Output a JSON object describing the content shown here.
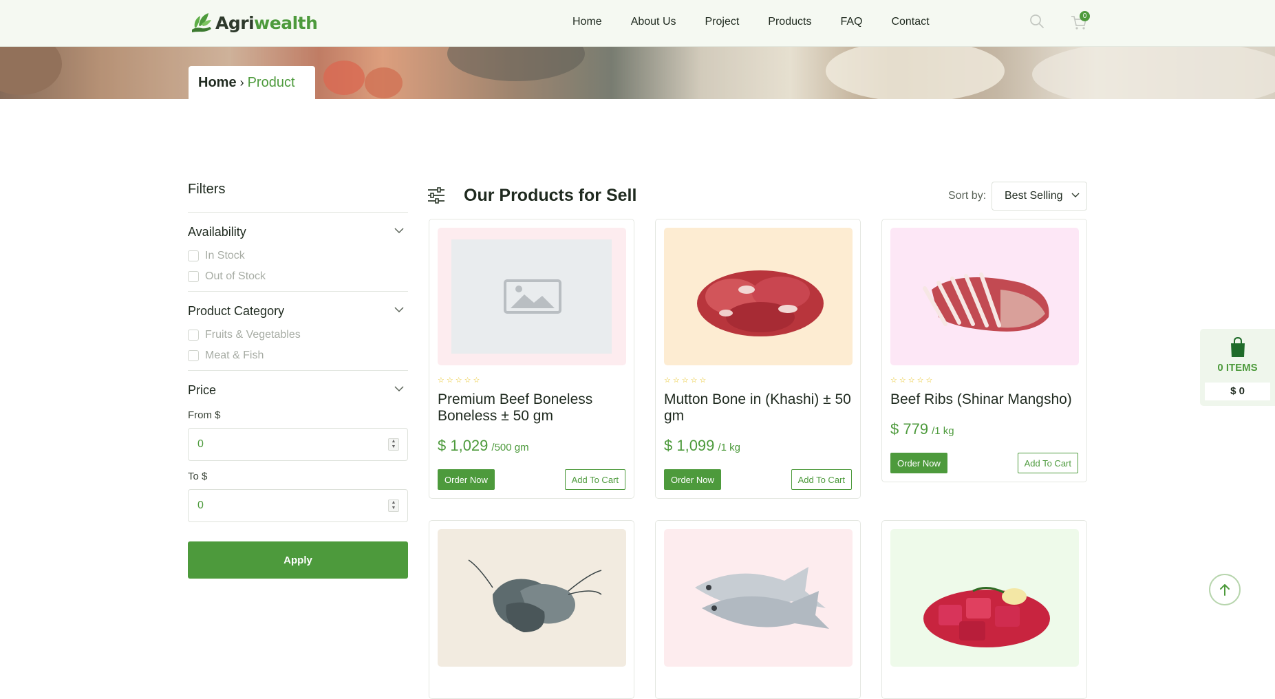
{
  "brand": {
    "name_part1": "Agri",
    "name_part2": "wealth"
  },
  "nav": [
    "Home",
    "About Us",
    "Project",
    "Products",
    "FAQ",
    "Contact"
  ],
  "header": {
    "cart_count": "0"
  },
  "breadcrumb": {
    "home": "Home",
    "current": "Product"
  },
  "filters": {
    "title": "Filters",
    "availability": {
      "title": "Availability",
      "options": [
        "In Stock",
        "Out of Stock"
      ]
    },
    "category": {
      "title": "Product Category",
      "options": [
        "Fruits & Vegetables",
        "Meat & Fish"
      ]
    },
    "price": {
      "title": "Price",
      "from_label": "From $",
      "to_label": "To $",
      "from_value": "0",
      "to_value": "0",
      "apply_label": "Apply"
    }
  },
  "products_header": {
    "title": "Our Products for Sell",
    "sort_label": "Sort by:",
    "sort_value": "Best Selling"
  },
  "products": [
    {
      "name": "Premium Beef Boneless Boneless ± 50 gm",
      "price": "$ 1,029",
      "unit": "/500 gm",
      "order_label": "Order Now",
      "cart_label": "Add To Cart",
      "bg": "#fdecef",
      "image": "placeholder"
    },
    {
      "name": "Mutton Bone in (Khashi) ± 50 gm",
      "price": "$ 1,099",
      "unit": "/1 kg",
      "order_label": "Order Now",
      "cart_label": "Add To Cart",
      "bg": "#fdecd2",
      "image": "mutton"
    },
    {
      "name": "Beef Ribs (Shinar Mangsho)",
      "price": "$ 779",
      "unit": "/1 kg",
      "order_label": "Order Now",
      "cart_label": "Add To Cart",
      "bg": "#fde7f6",
      "image": "ribs"
    },
    {
      "name": "",
      "price": "",
      "unit": "",
      "bg": "#f2ebe0",
      "image": "prawns"
    },
    {
      "name": "",
      "price": "",
      "unit": "",
      "bg": "#fdecee",
      "image": "fish"
    },
    {
      "name": "",
      "price": "",
      "unit": "",
      "bg": "#eefaea",
      "image": "beef-cubes"
    }
  ],
  "floating_cart": {
    "items": "0 ITEMS",
    "total": "$ 0"
  },
  "colors": {
    "accent": "#4d9a3c",
    "text": "#1f2a1f",
    "star": "#e7c21f"
  }
}
